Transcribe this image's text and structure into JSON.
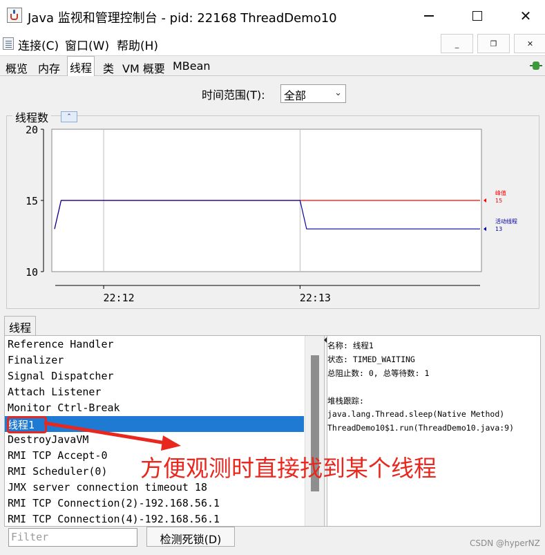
{
  "window": {
    "title": "Java 监视和管理控制台 - pid: 22168 ThreadDemo10"
  },
  "menu": {
    "items": [
      "连接(C)",
      "窗口(W)",
      "帮助(H)"
    ]
  },
  "tabs": [
    {
      "label": "概览"
    },
    {
      "label": "内存"
    },
    {
      "label": "线程",
      "active": true
    },
    {
      "label": "类"
    },
    {
      "label": "VM 概要"
    },
    {
      "label": "MBean"
    }
  ],
  "time_range": {
    "label": "时间范围(T):",
    "value": "全部"
  },
  "chart_panel": {
    "title": "线程数"
  },
  "chart_data": {
    "type": "line",
    "title": "线程数",
    "x": [
      "22:11:45",
      "22:11:47",
      "22:13:00",
      "22:13:02",
      "22:13:55"
    ],
    "xticks": [
      "22:12",
      "22:13"
    ],
    "ylim": [
      10,
      20
    ],
    "yticks": [
      10,
      15,
      20
    ],
    "series": [
      {
        "name": "峰值",
        "color": "#ff0000",
        "values": [
          13,
          15,
          15,
          15,
          15
        ],
        "current": "15"
      },
      {
        "name": "活动线程",
        "color": "#0000a0",
        "values": [
          13,
          15,
          15,
          13,
          13
        ],
        "current": "13"
      }
    ]
  },
  "threads": {
    "tab_label": "线程",
    "list": [
      "Reference Handler",
      "Finalizer",
      "Signal Dispatcher",
      "Attach Listener",
      "Monitor Ctrl-Break",
      "线程1",
      "DestroyJavaVM",
      "RMI TCP Accept-0",
      "RMI Scheduler(0)",
      "JMX server connection timeout 18",
      "RMI TCP Connection(2)-192.168.56.1",
      "RMI TCP Connection(4)-192.168.56.1"
    ],
    "selected_index": 5,
    "detail": {
      "name_line": "名称: 线程1",
      "state_line": "状态: TIMED_WAITING",
      "counts_line": "总阻止数: 0, 总等待数: 1",
      "stack_label": "堆栈跟踪:",
      "stack": [
        "java.lang.Thread.sleep(Native Method)",
        "ThreadDemo10$1.run(ThreadDemo10.java:9)"
      ]
    }
  },
  "annotation": {
    "text": "方便观测时直接找到某个线程",
    "color": "#e8281f"
  },
  "bottom": {
    "filter_placeholder": "Filter",
    "deadlock_button": "检测死锁(D)"
  },
  "watermark": "CSDN @hyperNZ"
}
